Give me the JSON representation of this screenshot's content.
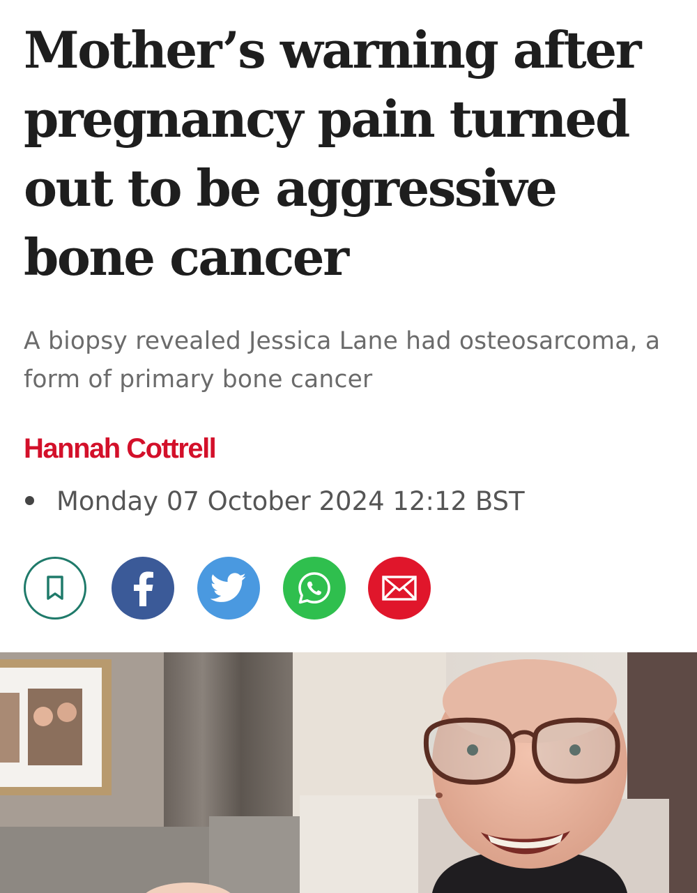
{
  "article": {
    "headline": "Mother’s warning after pregnancy pain turned out to be aggressive bone cancer",
    "standfirst": "A biopsy revealed Jessica Lane had osteosarcoma, a form of primary bone cancer",
    "author": "Hannah Cottrell",
    "date": "Monday 07 October 2024 12:12 BST"
  },
  "share": {
    "buttons": [
      {
        "name": "bookmark",
        "icon": "bookmark-icon",
        "color": "#1f7a6a"
      },
      {
        "name": "facebook",
        "icon": "facebook-icon",
        "color": "#3b5a98"
      },
      {
        "name": "twitter",
        "icon": "twitter-icon",
        "color": "#4a99e0"
      },
      {
        "name": "whatsapp",
        "icon": "whatsapp-icon",
        "color": "#2fbf4e"
      },
      {
        "name": "email",
        "icon": "envelope-icon",
        "color": "#e0162b"
      }
    ]
  },
  "colors": {
    "author": "#d3102a",
    "headline": "#1e1e1e",
    "standfirst": "#6b6b6b"
  }
}
